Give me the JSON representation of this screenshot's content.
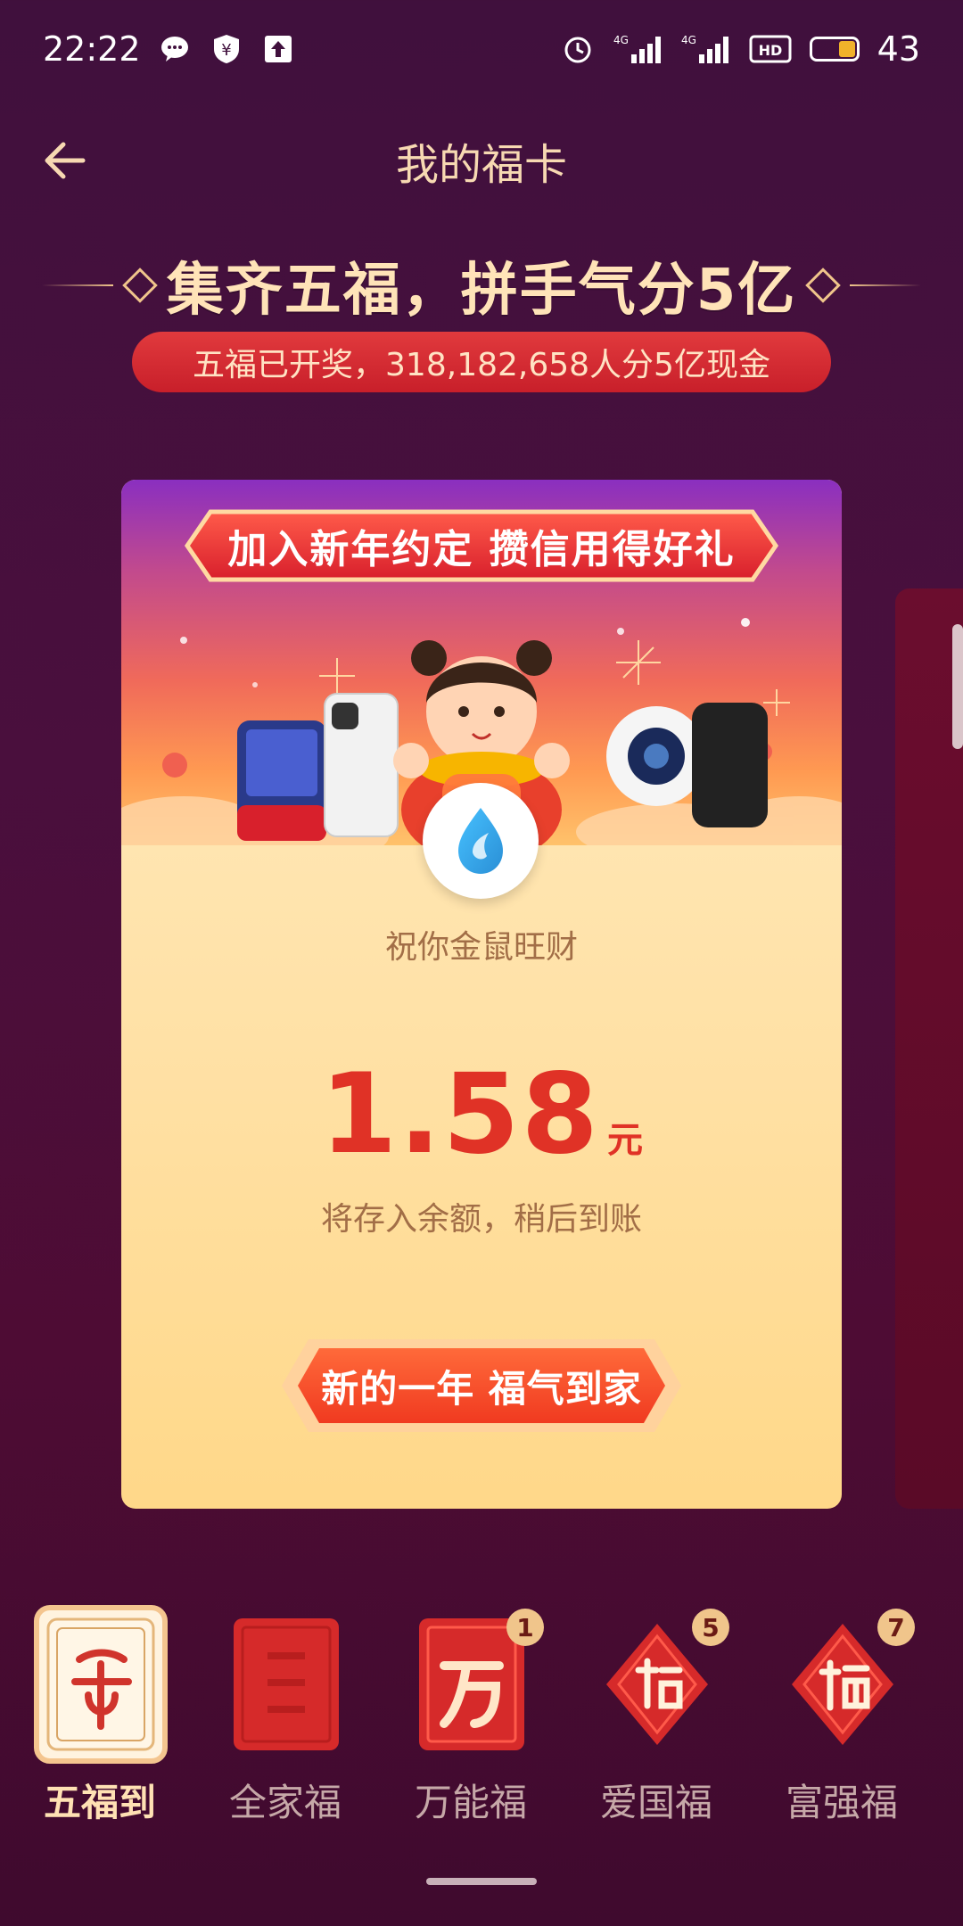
{
  "status_bar": {
    "time": "22:22",
    "signal_1": "4G",
    "signal_2": "4G",
    "battery_level": "43"
  },
  "header": {
    "title": "我的福卡"
  },
  "banner": {
    "title": "集齐五福，拼手气分5亿",
    "subtitle": "五福已开奖，318,182,658人分5亿现金"
  },
  "card": {
    "ribbon": "加入新年约定 攒信用得好礼",
    "blessing": "祝你金鼠旺财",
    "amount": "1.58",
    "unit": "元",
    "note": "将存入余额，稍后到账",
    "cta": "新的一年 福气到家"
  },
  "fu_cards": [
    {
      "label": "五福到",
      "badge": "",
      "selected": true
    },
    {
      "label": "全家福",
      "badge": "",
      "selected": false
    },
    {
      "label": "万能福",
      "badge": "1",
      "selected": false
    },
    {
      "label": "爱国福",
      "badge": "5",
      "selected": false
    },
    {
      "label": "富强福",
      "badge": "7",
      "selected": false
    }
  ],
  "colors": {
    "accent_red": "#e03226",
    "gold": "#f0c58b",
    "background": "#4a0f3d"
  }
}
